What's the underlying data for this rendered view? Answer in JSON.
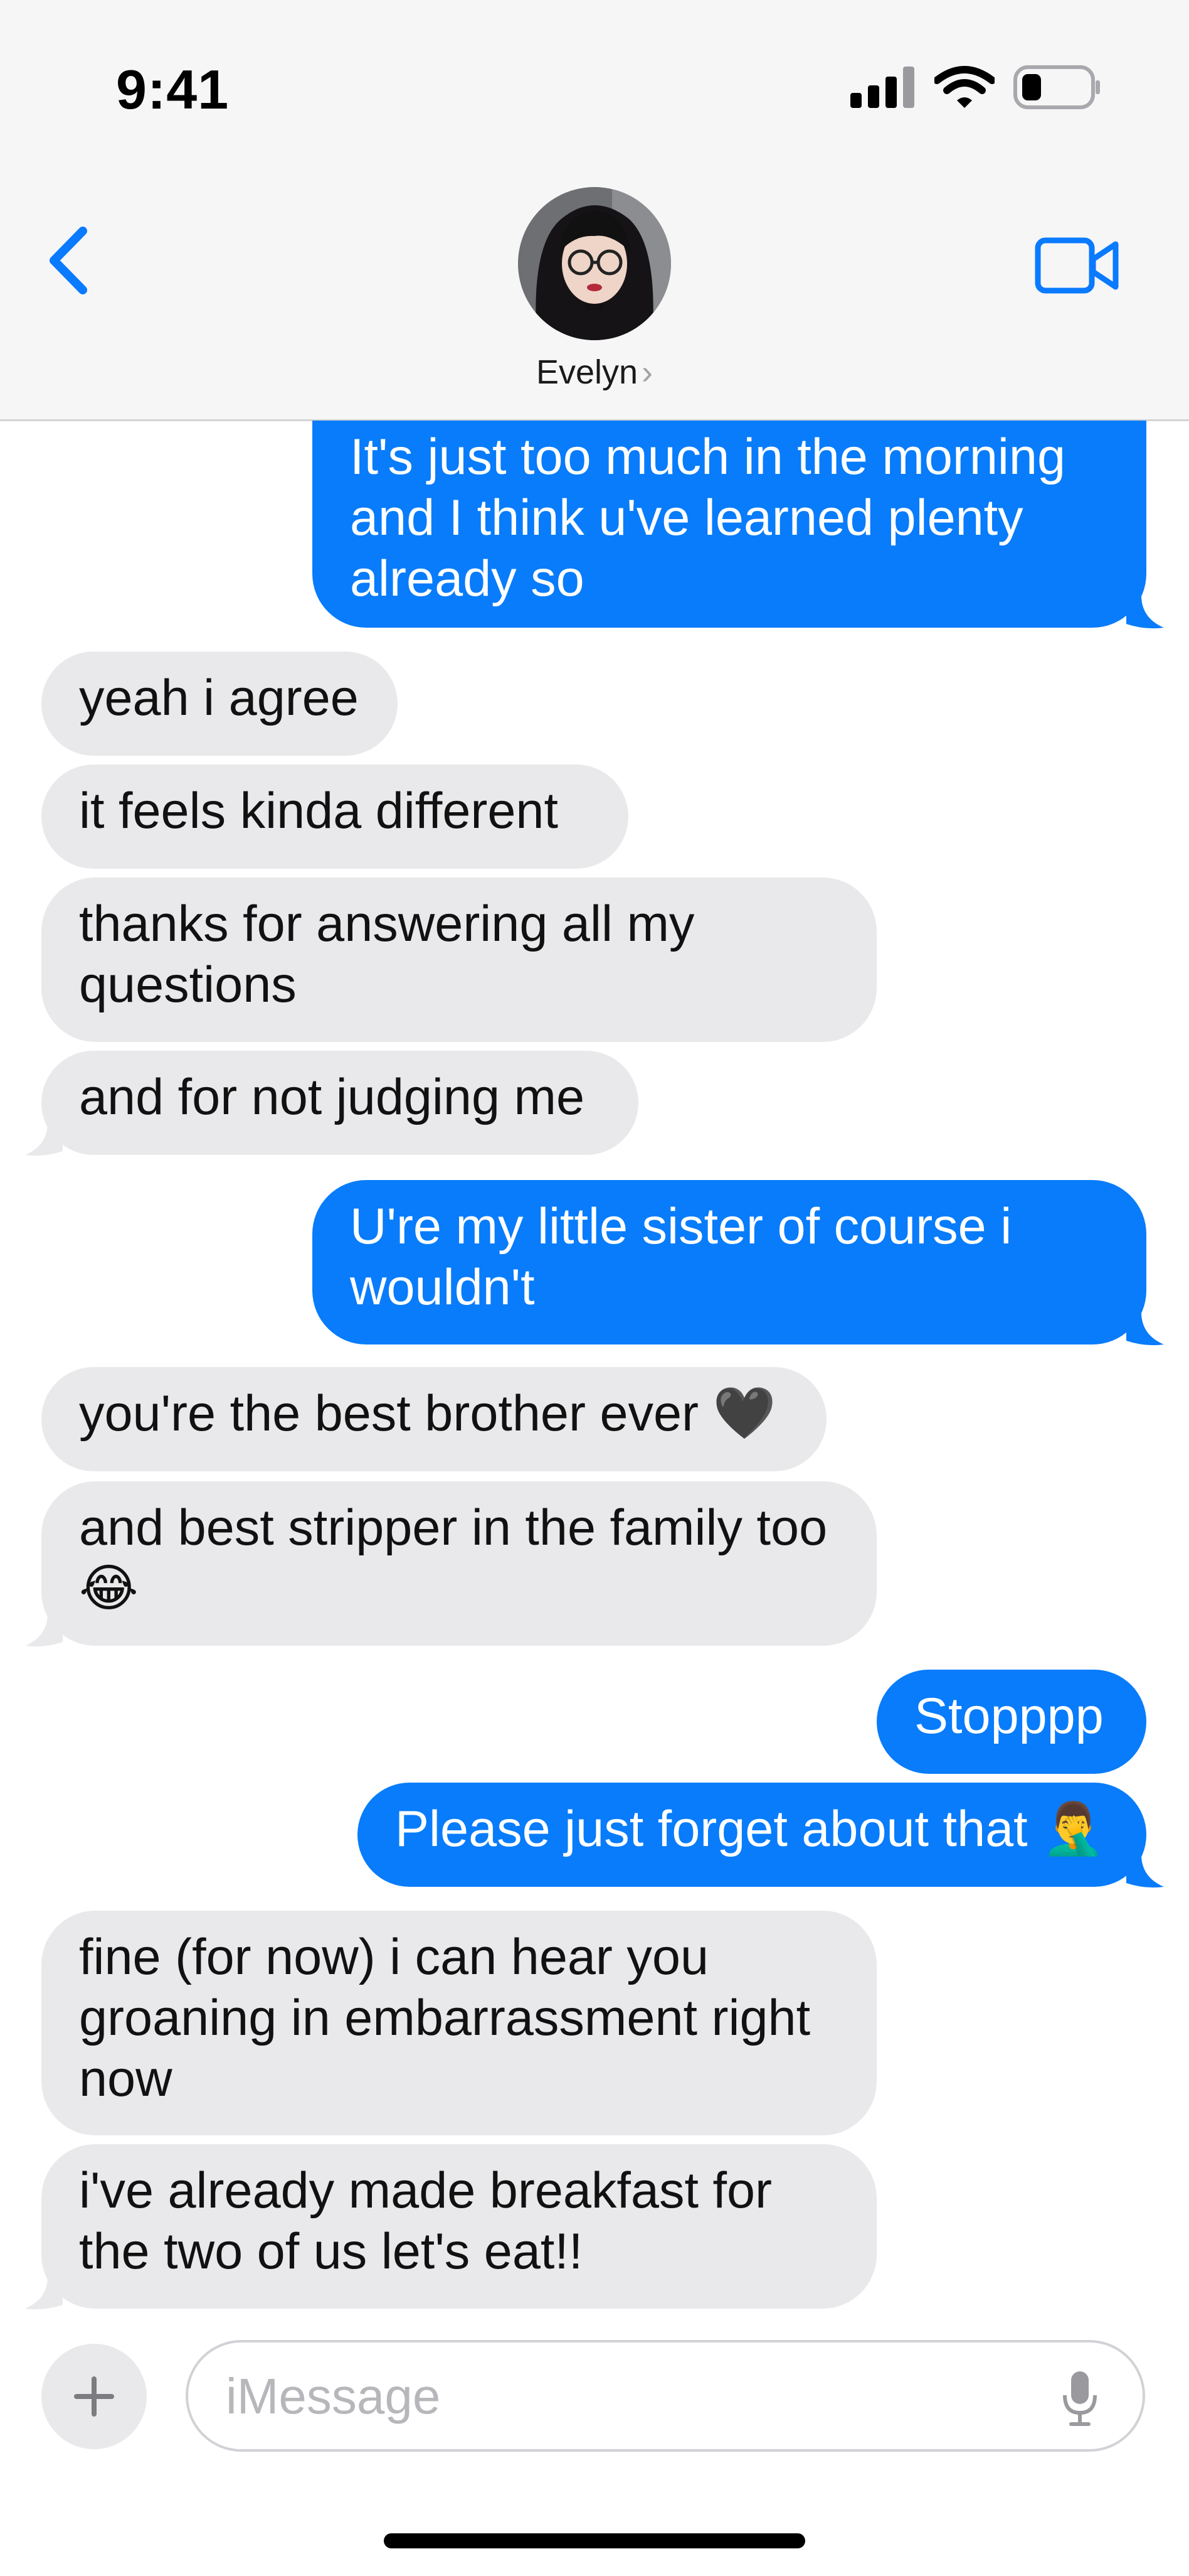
{
  "status_bar": {
    "time": "9:41"
  },
  "header": {
    "contact_name": "Evelyn",
    "chevron": "›"
  },
  "messages": [
    {
      "side": "out",
      "text": "It's just too much in the morning and I think u've learned plenty already so"
    },
    {
      "side": "in",
      "text": "yeah i agree"
    },
    {
      "side": "in",
      "text": "it feels kinda different"
    },
    {
      "side": "in",
      "text": "thanks for answering all my questions"
    },
    {
      "side": "in",
      "text": "and for not judging me"
    },
    {
      "side": "out",
      "text": "U're my little sister of course i wouldn't"
    },
    {
      "side": "in",
      "text": "you're the best brother ever 🖤"
    },
    {
      "side": "in",
      "text": "and best stripper in the family too 😂"
    },
    {
      "side": "out",
      "text": "Stopppp"
    },
    {
      "side": "out",
      "text": "Please just forget about that 🤦‍♂️"
    },
    {
      "side": "in",
      "text": "fine (for now) i can hear you groaning in embarrassment right now"
    },
    {
      "side": "in",
      "text": "i've already made breakfast for the two of us let's eat!!"
    }
  ],
  "composer": {
    "placeholder": "iMessage"
  },
  "colors": {
    "outgoing": "#087cfb",
    "incoming": "#e9e9eb",
    "accent": "#0a7afe"
  }
}
